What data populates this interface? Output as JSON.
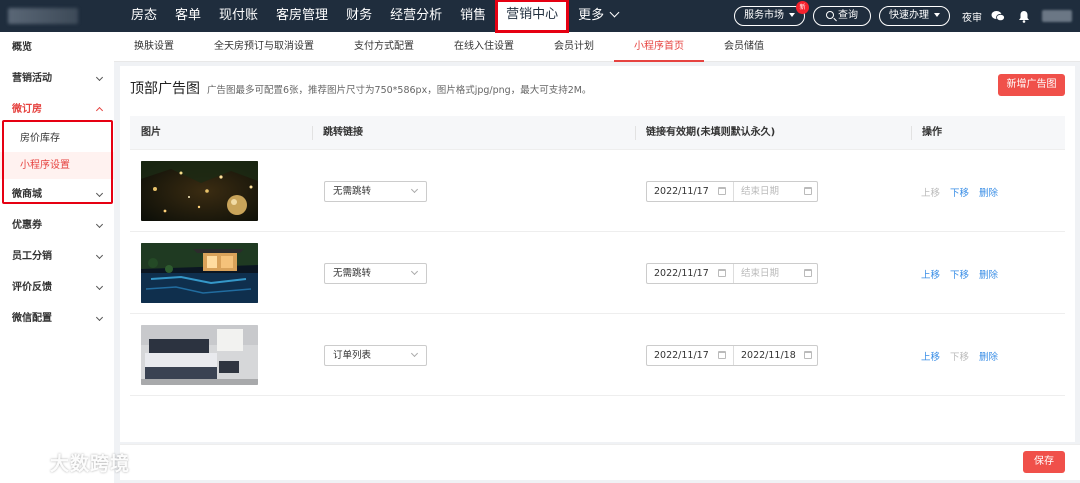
{
  "topnav": {
    "items": [
      "房态",
      "客单",
      "现付账",
      "客房管理",
      "财务",
      "经营分析",
      "销售",
      "营销中心",
      "更多"
    ],
    "active": "营销中心"
  },
  "topright": {
    "service_market": "服务市场",
    "new_badge": "新",
    "query": "查询",
    "quick_action": "快速办理",
    "night_audit": "夜审"
  },
  "sidebar": {
    "items": [
      {
        "label": "概览"
      },
      {
        "label": "营销活动"
      },
      {
        "label": "微订房"
      },
      {
        "label": "房价库存"
      },
      {
        "label": "小程序设置"
      },
      {
        "label": "微商城"
      },
      {
        "label": "优惠券"
      },
      {
        "label": "员工分销"
      },
      {
        "label": "评价反馈"
      },
      {
        "label": "微信配置"
      }
    ]
  },
  "subnav": {
    "tabs": [
      "换肤设置",
      "全天房预订与取消设置",
      "支付方式配置",
      "在线入住设置",
      "会员计划",
      "小程序首页",
      "会员储值"
    ],
    "active": "小程序首页"
  },
  "panel": {
    "title": "顶部广告图",
    "hint": "广告图最多可配置6张，推荐图片尺寸为750*586px，图片格式jpg/png，最大可支持2M。",
    "add_button": "新增广告图"
  },
  "table": {
    "headers": [
      "图片",
      "跳转链接",
      "链接有效期(未填则默认永久)",
      "操作"
    ],
    "rows": [
      {
        "image": "christmas-ornaments",
        "link": "无需跳转",
        "start": "2022/11/17",
        "end": "",
        "end_placeholder": "结束日期",
        "ops": [
          "上移",
          "下移",
          "删除"
        ],
        "ops_enabled": [
          false,
          true,
          true
        ]
      },
      {
        "image": "hotel-pool-night",
        "link": "无需跳转",
        "start": "2022/11/17",
        "end": "",
        "end_placeholder": "结束日期",
        "ops": [
          "上移",
          "下移",
          "删除"
        ],
        "ops_enabled": [
          true,
          true,
          true
        ]
      },
      {
        "image": "bedroom-interior",
        "link": "订单列表",
        "start": "2022/11/17",
        "end": "2022/11/18",
        "end_placeholder": "结束日期",
        "ops": [
          "上移",
          "下移",
          "删除"
        ],
        "ops_enabled": [
          true,
          false,
          true
        ]
      }
    ]
  },
  "footer": {
    "save_button": "保存"
  },
  "watermark": "大数跨境",
  "colors": {
    "topbar": "#1f2d3d",
    "accent": "#e64340",
    "primary_button": "#f0504a",
    "link": "#3a8ee6"
  }
}
